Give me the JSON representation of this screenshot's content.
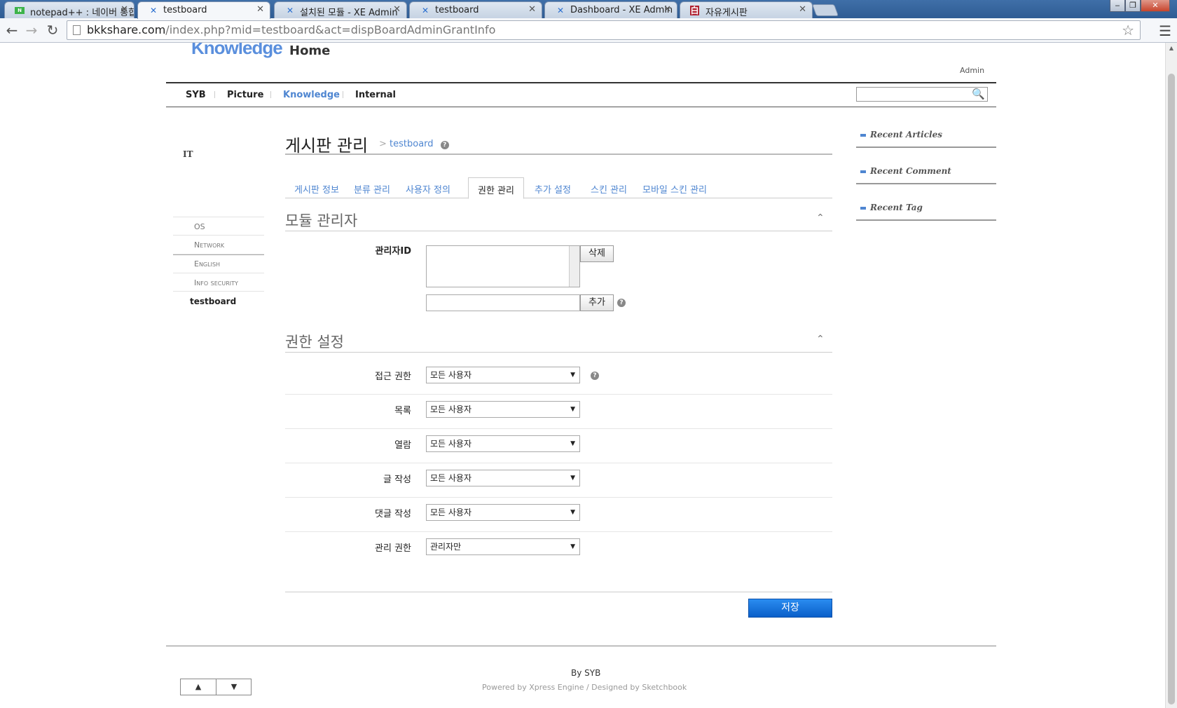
{
  "browser": {
    "tabs": [
      {
        "title": "notepad++ : 네이버 통합",
        "favicon": "naver-icon"
      },
      {
        "title": "testboard",
        "favicon": "xe-icon"
      },
      {
        "title": "설치된 모듈 - XE Admin",
        "favicon": "xe-icon"
      },
      {
        "title": "testboard",
        "favicon": "xe-icon"
      },
      {
        "title": "Dashboard - XE Admin",
        "favicon": "xe-icon"
      },
      {
        "title": "자유게시판",
        "favicon": "board-icon"
      }
    ],
    "url_host": "bkkshare.com",
    "url_path": "/index.php?mid=testboard&act=dispBoardAdminGrantInfo"
  },
  "header": {
    "logo": "Knowledge",
    "home": "Home",
    "admin": "Admin",
    "gnb": [
      "SYB",
      "Picture",
      "Knowledge",
      "Internal"
    ],
    "search_placeholder": ""
  },
  "lnb": {
    "category": "IT",
    "items": [
      "OS",
      "Network",
      "English",
      "Info security"
    ],
    "current": "testboard"
  },
  "content": {
    "title": "게시판 관리",
    "crumb_sep": ">",
    "mid": "testboard",
    "tabs": [
      "게시판 정보",
      "분류 관리",
      "사용자 정의",
      "권한 관리",
      "추가 설정",
      "스킨 관리",
      "모바일 스킨 관리"
    ],
    "active_tab": "권한 관리",
    "section_admin": {
      "title": "모듈 관리자",
      "label": "관리자ID",
      "delete_btn": "삭제",
      "add_btn": "추가"
    },
    "section_grant": {
      "title": "권한 설정",
      "rows": [
        {
          "label": "접근 권한",
          "value": "모든 사용자"
        },
        {
          "label": "목록",
          "value": "모든 사용자"
        },
        {
          "label": "열람",
          "value": "모든 사용자"
        },
        {
          "label": "글 작성",
          "value": "모든 사용자"
        },
        {
          "label": "댓글 작성",
          "value": "모든 사용자"
        },
        {
          "label": "관리 권한",
          "value": "관리자만"
        }
      ]
    },
    "save_btn": "저장",
    "help": "?"
  },
  "sidebar": {
    "widgets": [
      "Recent Articles",
      "Recent Comment",
      "Recent Tag"
    ]
  },
  "footer": {
    "by": "By SYB",
    "powered": "Powered by Xpress Engine   /   Designed by Sketchbook",
    "up": "▲",
    "down": "▼"
  }
}
